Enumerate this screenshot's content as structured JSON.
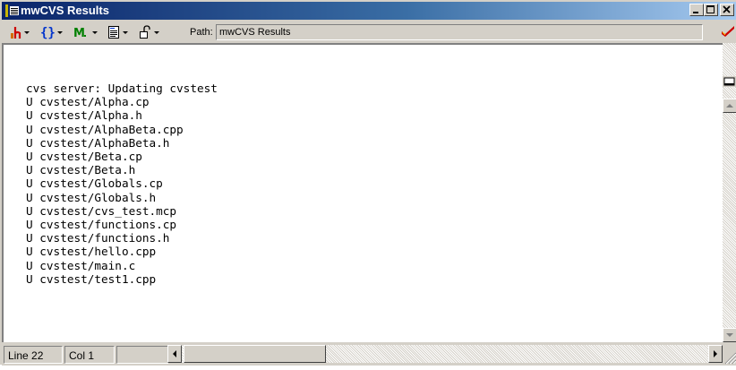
{
  "window": {
    "title": "mwCVS Results"
  },
  "toolbar": {
    "path_label": "Path:",
    "path_value": "mwCVS Results",
    "icons": [
      "header-icon",
      "functions-icon",
      "markers-icon",
      "document-icon",
      "lock-icon"
    ]
  },
  "output": {
    "lines": [
      "cvs server: Updating cvstest",
      "U cvstest/Alpha.cp",
      "U cvstest/Alpha.h",
      "U cvstest/AlphaBeta.cpp",
      "U cvstest/AlphaBeta.h",
      "U cvstest/Beta.cp",
      "U cvstest/Beta.h",
      "U cvstest/Globals.cp",
      "U cvstest/Globals.h",
      "U cvstest/cvs_test.mcp",
      "U cvstest/functions.cp",
      "U cvstest/functions.h",
      "U cvstest/hello.cpp",
      "U cvstest/main.c",
      "U cvstest/test1.cpp"
    ]
  },
  "status": {
    "line": "Line 22",
    "col": "Col 1"
  },
  "colors": {
    "title_bar": "#0a246a",
    "face": "#d4d0c8",
    "icon_orange": "#d46a00",
    "icon_blue": "#0033cc",
    "icon_red": "#cc0000"
  }
}
